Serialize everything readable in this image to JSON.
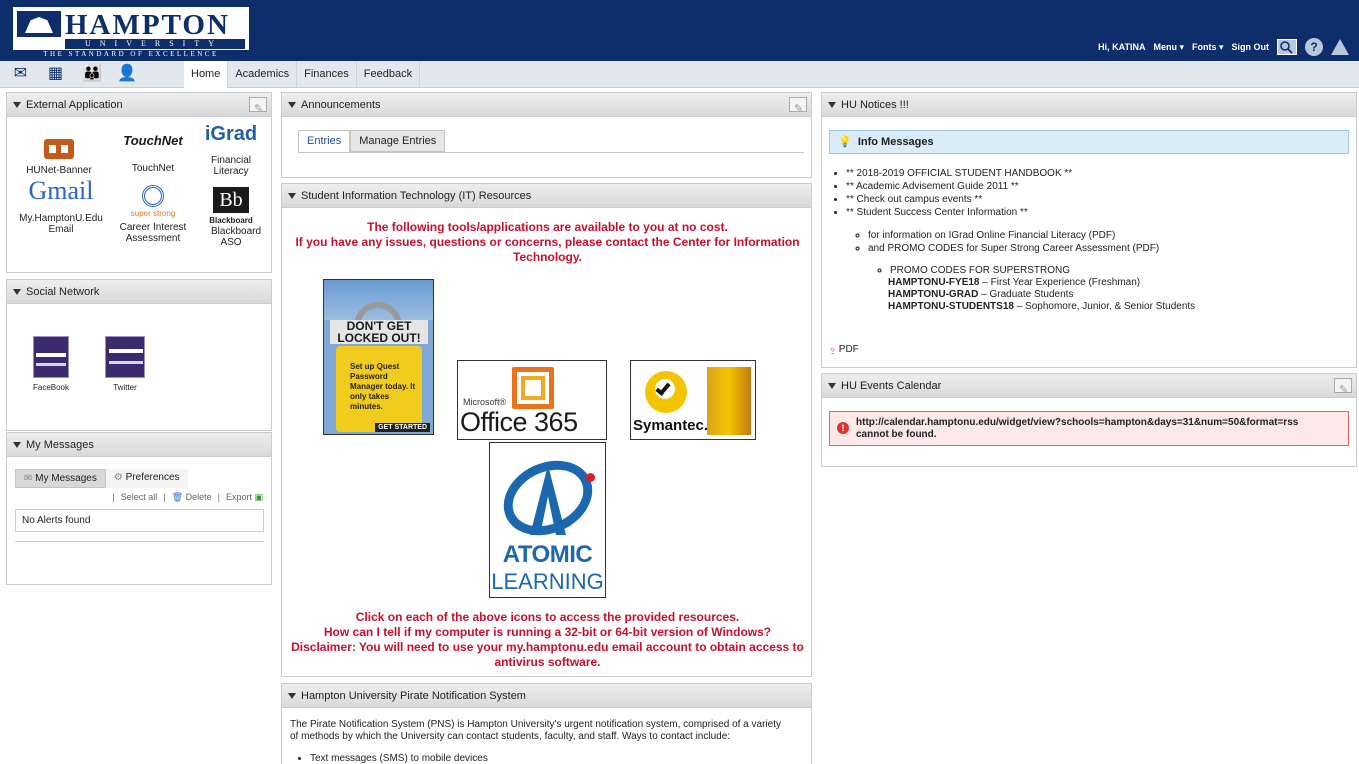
{
  "logo": {
    "name": "HAMPTON",
    "university": "UNIVERSITY",
    "motto": "THE STANDARD OF EXCELLENCE"
  },
  "usernav": {
    "greeting": "Hi, KATINA",
    "menu": "Menu ▾",
    "fonts": "Fonts ▾",
    "signout": "Sign Out"
  },
  "navtabs": [
    "Home",
    "Academics",
    "Finances",
    "Feedback"
  ],
  "external": {
    "title": "External Application",
    "apps": [
      {
        "label": "HUNet-Banner"
      },
      {
        "label": "TouchNet",
        "logo": "TouchNet"
      },
      {
        "label": "Financial Literacy",
        "logo": "iGrad"
      },
      {
        "label": "My.HamptonU.Edu Email",
        "logo": "Gmail"
      },
      {
        "label": "Career Interest Assessment",
        "logo": "super strong"
      },
      {
        "label": "Blackboard ASO",
        "logo": "Bb",
        "sublogo": "Blackboard"
      }
    ]
  },
  "social": {
    "title": "Social Network",
    "items": [
      {
        "label": "FaceBook"
      },
      {
        "label": "Twitter"
      }
    ]
  },
  "messages": {
    "title": "My Messages",
    "tab1": "My Messages",
    "tab2": "Preferences",
    "select_all": "Select all",
    "delete": "Delete",
    "export": "Export",
    "empty": "No Alerts found"
  },
  "announcements": {
    "title": "Announcements",
    "tab1": "Entries",
    "tab2": "Manage Entries"
  },
  "it": {
    "title": "Student Information Technology (IT) Resources",
    "intro1": "The following tools/applications are available to you at no cost.",
    "intro2": "If you have any issues, questions or concerns, please contact the Center for Information Technology.",
    "lock_title": "DON'T GET LOCKED OUT!",
    "lock_text": "Set up Quest Password Manager today. It only takes minutes.",
    "lock_btn": "GET STARTED",
    "office_small": "Microsoft®",
    "office_big": "Office 365",
    "symantec": "Symantec.",
    "atomic1": "ATOMIC",
    "atomic2": "LEARNING",
    "outro1": "Click on each of the above icons to access the provided resources.",
    "outro2": "How can I tell if my computer is running a 32-bit or 64-bit version of Windows?",
    "outro3": "Disclaimer: You will need to use your my.hamptonu.edu email account to obtain access to antivirus software."
  },
  "pns": {
    "title": "Hampton University Pirate Notification System",
    "text": "The Pirate Notification System (PNS) is Hampton University's urgent notification system, comprised of a variety of methods by which the University can contact students, faculty, and staff. Ways to contact include:",
    "item1": "Text messages (SMS) to mobile devices"
  },
  "notices": {
    "title": "HU Notices !!!",
    "info": "Info Messages",
    "items": [
      "** 2018-2019 OFFICIAL STUDENT HANDBOOK **",
      "** Academic Advisement Guide 2011 **",
      "** Check out campus events **",
      "** Student Success Center Information **"
    ],
    "sub": [
      "for information on IGrad Online Financial Literacy (PDF)",
      "and PROMO CODES for Super Strong Career Assessment (PDF)"
    ],
    "promo_head": "PROMO CODES FOR SUPERSTRONG",
    "promo": [
      {
        "code": "HAMPTONU-FYE18",
        "desc": " – First Year Experience (Freshman)"
      },
      {
        "code": "HAMPTONU-GRAD",
        "desc": " – Graduate Students"
      },
      {
        "code": "HAMPTONU-STUDENTS18",
        "desc": " – Sophomore, Junior, & Senior Students"
      }
    ],
    "pdf": "PDF"
  },
  "events": {
    "title": "HU Events Calendar",
    "error1": "http://calendar.hamptonu.edu/widget/view?schools=hampton&days=31&num=50&format=rss",
    "error2": "cannot be found."
  },
  "colors": {
    "header_bg": "#0d2d6b",
    "nav_bg": "#e3e8ef",
    "red": "#c8102e",
    "info_bg": "#d9ecf8",
    "error_bg": "#fde8e8"
  }
}
